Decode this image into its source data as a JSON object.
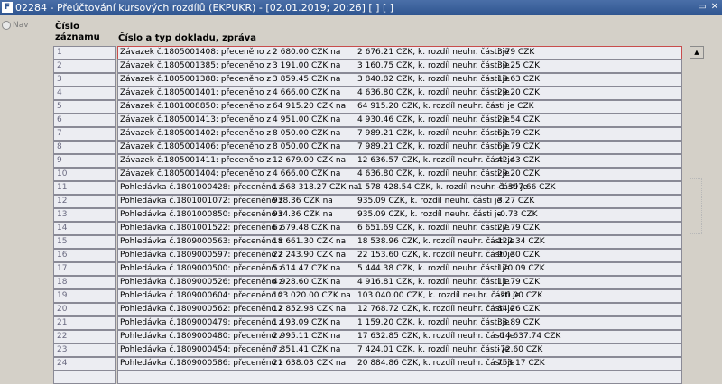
{
  "window": {
    "app_icon": "F",
    "title": "02284 - Přeúčtování kursových rozdílů (EKPUKR) - [02.01.2019; 20:26] [ ] [ ]",
    "restore_glyph": "▭",
    "close_glyph": "✕"
  },
  "nav": {
    "label": "Nav"
  },
  "columns": {
    "num_header_1": "Číslo",
    "num_header_2": "záznamu",
    "desc_header": "Číslo a typ dokladu, zpráva"
  },
  "rows": [
    {
      "num": "1",
      "c1": "Závazek č.1805001408: přeceněno z",
      "c2": "2 680.00 CZK na",
      "c3": "2 676.21 CZK, k. rozdíl neuhr. části je",
      "c4": "3.79 CZK"
    },
    {
      "num": "2",
      "c1": "Závazek č.1805001385: přeceněno z",
      "c2": "3 191.00 CZK na",
      "c3": "3 160.75 CZK, k. rozdíl neuhr. části je",
      "c4": "30.25 CZK"
    },
    {
      "num": "3",
      "c1": "Závazek č.1805001388: přeceněno z",
      "c2": "3 859.45 CZK na",
      "c3": "3 840.82 CZK, k. rozdíl neuhr. části je",
      "c4": "18.63 CZK"
    },
    {
      "num": "4",
      "c1": "Závazek č.1805001401: přeceněno z",
      "c2": "4 666.00 CZK na",
      "c3": "4 636.80 CZK, k. rozdíl neuhr. části je",
      "c4": "29.20 CZK"
    },
    {
      "num": "5",
      "c1": "Závazek č.1801008850: přeceněno z",
      "c2": "64 915.20 CZK na",
      "c3": "64 915.20 CZK, k. rozdíl neuhr. části je  CZK",
      "c4": ""
    },
    {
      "num": "6",
      "c1": "Závazek č.1805001413: přeceněno z",
      "c2": "4 951.00 CZK na",
      "c3": "4 930.46 CZK, k. rozdíl neuhr. části je",
      "c4": "20.54 CZK"
    },
    {
      "num": "7",
      "c1": "Závazek č.1805001402: přeceněno z",
      "c2": "8 050.00 CZK na",
      "c3": "7 989.21 CZK, k. rozdíl neuhr. části je",
      "c4": "60.79 CZK"
    },
    {
      "num": "8",
      "c1": "Závazek č.1805001406: přeceněno z",
      "c2": "8 050.00 CZK na",
      "c3": "7 989.21 CZK, k. rozdíl neuhr. části je",
      "c4": "60.79 CZK"
    },
    {
      "num": "9",
      "c1": "Závazek č.1805001411: přeceněno z",
      "c2": "12 679.00 CZK na",
      "c3": "12 636.57 CZK, k. rozdíl neuhr. části je",
      "c4": "42.43 CZK"
    },
    {
      "num": "10",
      "c1": "Závazek č.1805001404: přeceněno z",
      "c2": "4 666.00 CZK na",
      "c3": "4 636.80 CZK, k. rozdíl neuhr. části je",
      "c4": "29.20 CZK"
    },
    {
      "num": "11",
      "c1": "Pohledávka č.1801000428: přeceněno z",
      "c2": "1 568 318.27 CZK na",
      "c3": "1 578 428.54 CZK, k. rozdíl neuhr. části je",
      "c4": "-1 397.66 CZK"
    },
    {
      "num": "12",
      "c1": "Pohledávka č.1801001072: přeceněno z",
      "c2": "938.36 CZK na",
      "c3": "935.09 CZK, k. rozdíl neuhr. části je",
      "c4": "3.27 CZK"
    },
    {
      "num": "13",
      "c1": "Pohledávka č.1801000850: přeceněno z",
      "c2": "934.36 CZK na",
      "c3": "935.09 CZK, k. rozdíl neuhr. části je",
      "c4": "-0.73 CZK"
    },
    {
      "num": "14",
      "c1": "Pohledávka č.1801001522: přeceněno z",
      "c2": "6 679.48 CZK na",
      "c3": "6 651.69 CZK, k. rozdíl neuhr. části je",
      "c4": "27.79 CZK"
    },
    {
      "num": "15",
      "c1": "Pohledávka č.1809000563: přeceněno z",
      "c2": "18 661.30 CZK na",
      "c3": "18 538.96 CZK, k. rozdíl neuhr. části je",
      "c4": "122.34 CZK"
    },
    {
      "num": "16",
      "c1": "Pohledávka č.1809000597: přeceněno z",
      "c2": "22 243.90 CZK na",
      "c3": "22 153.60 CZK, k. rozdíl neuhr. části je",
      "c4": "90.30 CZK"
    },
    {
      "num": "17",
      "c1": "Pohledávka č.1809000500: přeceněno z",
      "c2": "5 614.47 CZK na",
      "c3": "5 444.38 CZK, k. rozdíl neuhr. části je",
      "c4": "170.09 CZK"
    },
    {
      "num": "18",
      "c1": "Pohledávka č.1809000526: přeceněno z",
      "c2": "4 928.60 CZK na",
      "c3": "4 916.81 CZK, k. rozdíl neuhr. části je",
      "c4": "11.79 CZK"
    },
    {
      "num": "19",
      "c1": "Pohledávka č.1809000604: přeceněno z",
      "c2": "103 020.00 CZK na",
      "c3": "103 040.00 CZK, k. rozdíl neuhr. části je",
      "c4": "-20.00 CZK"
    },
    {
      "num": "20",
      "c1": "Pohledávka č.1809000562: přeceněno z",
      "c2": "12 852.98 CZK na",
      "c3": "12 768.72 CZK, k. rozdíl neuhr. části je",
      "c4": "84.26 CZK"
    },
    {
      "num": "21",
      "c1": "Pohledávka č.1809000479: přeceněno z",
      "c2": "1 193.09 CZK na",
      "c3": "1 159.20 CZK, k. rozdíl neuhr. části je",
      "c4": "33.89 CZK"
    },
    {
      "num": "22",
      "c1": "Pohledávka č.1809000480: přeceněno z",
      "c2": "2 995.11 CZK na",
      "c3": "17 632.85 CZK, k. rozdíl neuhr. části je",
      "c4": "-14 637.74 CZK"
    },
    {
      "num": "23",
      "c1": "Pohledávka č.1809000454: přeceněno z",
      "c2": "7 351.41 CZK na",
      "c3": "7 424.01 CZK, k. rozdíl neuhr. části je",
      "c4": "-72.60 CZK"
    },
    {
      "num": "24",
      "c1": "Pohledávka č.1809000586: přeceněno z",
      "c2": "21 638.03 CZK na",
      "c3": "20 884.86 CZK, k. rozdíl neuhr. části je",
      "c4": "753.17 CZK"
    },
    {
      "num": "",
      "c1": "",
      "c2": "",
      "c3": "",
      "c4": ""
    }
  ],
  "scroll": {
    "up_glyph": "▲"
  }
}
